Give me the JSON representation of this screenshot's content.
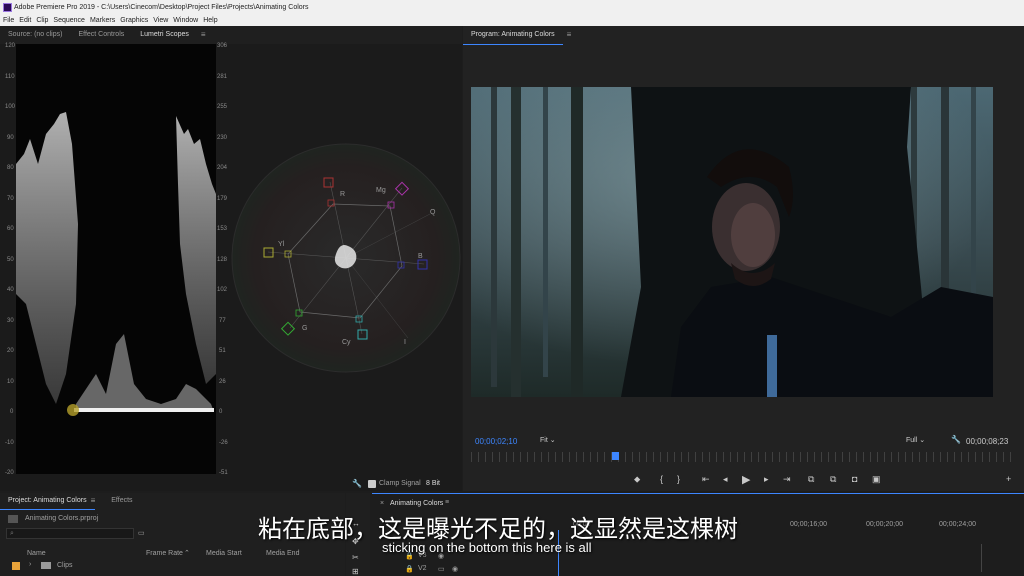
{
  "window": {
    "title": "Adobe Premiere Pro 2019 - C:\\Users\\Cinecom\\Desktop\\Project Files\\Projects\\Animating Colors"
  },
  "menu": [
    "File",
    "Edit",
    "Clip",
    "Sequence",
    "Markers",
    "Graphics",
    "View",
    "Window",
    "Help"
  ],
  "source_panel": {
    "tabs": [
      "Source: (no clips)",
      "Effect Controls",
      "Lumetri Scopes"
    ],
    "active_tab": "Lumetri Scopes",
    "left_axis": [
      "120",
      "110",
      "100",
      "90",
      "80",
      "70",
      "60",
      "50",
      "40",
      "30",
      "20",
      "10",
      "0",
      "-10",
      "-20"
    ],
    "right_axis": [
      "306",
      "281",
      "255",
      "230",
      "204",
      "179",
      "153",
      "128",
      "102",
      "77",
      "51",
      "26",
      "0",
      "-26",
      "-51"
    ],
    "vectorscope_labels": [
      "R",
      "Mg",
      "B",
      "Cy",
      "G",
      "Yl"
    ],
    "vectorscope_letters": [
      "Q",
      "I"
    ],
    "clamp_signal_label": "Clamp Signal",
    "bit_depth": "8 Bit"
  },
  "program_panel": {
    "title": "Program: Animating Colors",
    "timecode_current": "00;00;02;10",
    "fit": "Fit",
    "quality": "Full",
    "timecode_duration": "00;00;08;23"
  },
  "project_panel": {
    "tabs": [
      "Project: Animating Colors",
      "Effects"
    ],
    "file": "Animating Colors.prproj",
    "columns": [
      "Name",
      "Frame Rate",
      "Media Start",
      "Media End"
    ],
    "rows": [
      "Clips"
    ]
  },
  "timeline": {
    "tab": "Animating Colors",
    "ruler": [
      "00;00",
      "00;00;16;00",
      "00;00;20;00",
      "00;00;24;00"
    ],
    "tracks": [
      "V3",
      "V2"
    ]
  },
  "subtitles": {
    "chinese": "粘在底部，这是曝光不足的，这显然是这棵树",
    "english": "sticking on the bottom this here is all"
  }
}
